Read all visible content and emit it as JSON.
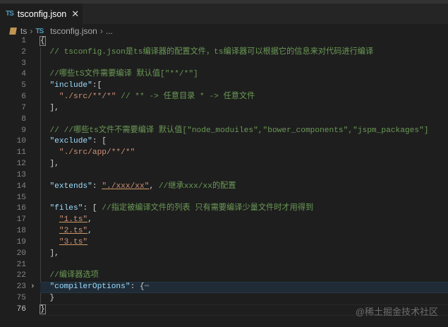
{
  "tab": {
    "icon": "ts-file-icon",
    "title": "tsconfig.json",
    "close": "✕"
  },
  "breadcrumb": {
    "folder": "ts",
    "file": "tsconfig.json",
    "more": "..."
  },
  "lines": [
    {
      "n": "1",
      "tokens": [
        [
          "brace",
          "{"
        ]
      ]
    },
    {
      "n": "2",
      "tokens": [
        [
          "comment",
          "  // tsconfig.json是ts编译器的配置文件，ts编译器可以根据它的信息来对代码进行编译"
        ]
      ]
    },
    {
      "n": "3",
      "tokens": []
    },
    {
      "n": "4",
      "tokens": [
        [
          "comment",
          "  //哪些tS文件需要编译 默认值[\"**/*\"]"
        ]
      ]
    },
    {
      "n": "5",
      "tokens": [
        [
          "punct",
          "  "
        ],
        [
          "key",
          "\"include\""
        ],
        [
          "punct",
          ":["
        ]
      ]
    },
    {
      "n": "6",
      "tokens": [
        [
          "punct",
          "    "
        ],
        [
          "str",
          "\"./src/**/*\""
        ],
        [
          "punct",
          " "
        ],
        [
          "comment",
          "// ** -> 任意目录 * -> 任意文件"
        ]
      ]
    },
    {
      "n": "7",
      "tokens": [
        [
          "punct",
          "  ],"
        ]
      ]
    },
    {
      "n": "8",
      "tokens": []
    },
    {
      "n": "9",
      "tokens": [
        [
          "comment",
          "  // //哪些ts文件不需要编译 默认值[\"node_moduiles\",\"bower_components\",\"jspm_packages\"]"
        ]
      ]
    },
    {
      "n": "10",
      "tokens": [
        [
          "punct",
          "  "
        ],
        [
          "key",
          "\"exclude\""
        ],
        [
          "punct",
          ": ["
        ]
      ]
    },
    {
      "n": "11",
      "tokens": [
        [
          "punct",
          "    "
        ],
        [
          "str",
          "\"./src/app/**/*\""
        ]
      ]
    },
    {
      "n": "12",
      "tokens": [
        [
          "punct",
          "  ],"
        ]
      ]
    },
    {
      "n": "13",
      "tokens": []
    },
    {
      "n": "14",
      "tokens": [
        [
          "punct",
          "  "
        ],
        [
          "key",
          "\"extends\""
        ],
        [
          "punct",
          ": "
        ],
        [
          "strul",
          "\"./xxx/xx\""
        ],
        [
          "punct",
          ", "
        ],
        [
          "comment",
          "//继承xxx/xx的配置"
        ]
      ]
    },
    {
      "n": "15",
      "tokens": []
    },
    {
      "n": "16",
      "tokens": [
        [
          "punct",
          "  "
        ],
        [
          "key",
          "\"files\""
        ],
        [
          "punct",
          ": [ "
        ],
        [
          "comment",
          "//指定被编译文件的列表 只有需要编译少量文件时才用得到"
        ]
      ]
    },
    {
      "n": "17",
      "tokens": [
        [
          "punct",
          "    "
        ],
        [
          "strul",
          "\"1.ts\""
        ],
        [
          "punct",
          ","
        ]
      ]
    },
    {
      "n": "18",
      "tokens": [
        [
          "punct",
          "    "
        ],
        [
          "strul",
          "\"2.ts\""
        ],
        [
          "punct",
          ","
        ]
      ]
    },
    {
      "n": "19",
      "tokens": [
        [
          "punct",
          "    "
        ],
        [
          "strul",
          "\"3.ts\""
        ]
      ]
    },
    {
      "n": "20",
      "tokens": [
        [
          "punct",
          "  ],"
        ]
      ]
    },
    {
      "n": "21",
      "tokens": []
    },
    {
      "n": "22",
      "tokens": [
        [
          "comment",
          "  //编译器选项"
        ]
      ]
    },
    {
      "n": "23",
      "folded": true,
      "tokens": [
        [
          "punct",
          "  "
        ],
        [
          "key",
          "\"compilerOptions\""
        ],
        [
          "punct",
          ": {"
        ],
        [
          "fold",
          "⋯"
        ]
      ]
    },
    {
      "n": "75",
      "tokens": [
        [
          "punct",
          "  }"
        ]
      ]
    },
    {
      "n": "76",
      "active": true,
      "tokens": [
        [
          "brace",
          "}"
        ]
      ]
    }
  ],
  "fold_icon": "›",
  "watermark": "@稀土掘金技术社区"
}
